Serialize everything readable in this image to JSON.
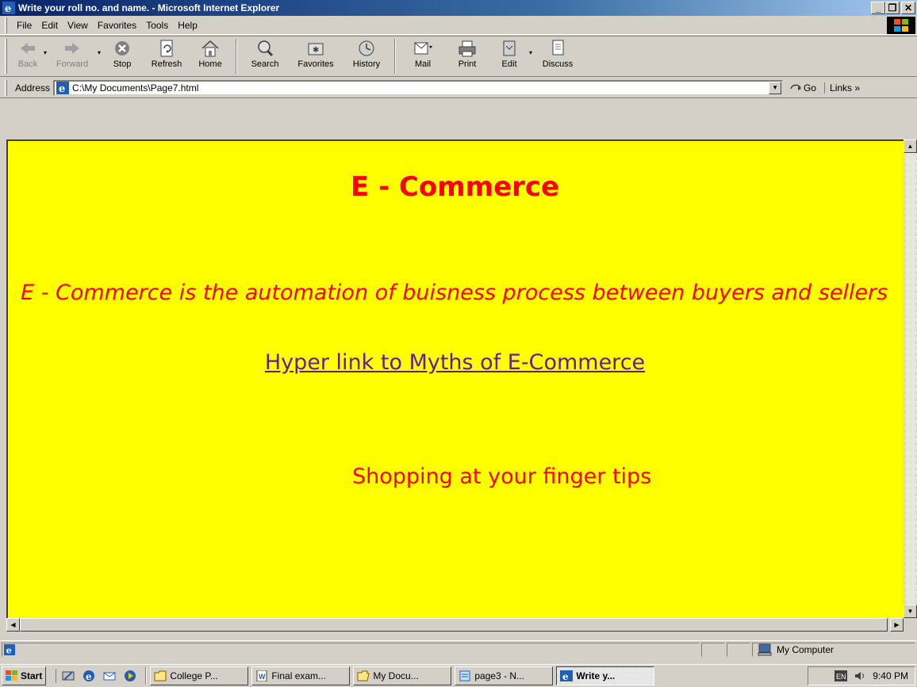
{
  "window": {
    "title": "Write your roll no. and name. - Microsoft Internet Explorer",
    "min_label": "_",
    "max_label": "❐",
    "close_label": "✕"
  },
  "menu": [
    {
      "label": "File",
      "icon": ""
    },
    {
      "label": "Edit"
    },
    {
      "label": "View"
    },
    {
      "label": "Favorites"
    },
    {
      "label": "Tools"
    },
    {
      "label": "Help"
    }
  ],
  "toolbar": {
    "back": "Back",
    "forward": "Forward",
    "stop": "Stop",
    "refresh": "Refresh",
    "home": "Home",
    "search": "Search",
    "favorites": "Favorites",
    "history": "History",
    "mail": "Mail",
    "print": "Print",
    "edit": "Edit",
    "discuss": "Discuss"
  },
  "address": {
    "label": "Address",
    "value": "C:\\My Documents\\Page7.html",
    "go": "Go",
    "links": "Links »"
  },
  "page": {
    "heading": "E - Commerce",
    "paragraph": "E - Commerce is the automation of buisness process between buyers and sellers",
    "link": "Hyper link to Myths of E-Commerce",
    "tagline": "Shopping at your finger tips",
    "background_color": "#ffff00",
    "text_color": "#ff0000",
    "link_color": "#6a1b8a"
  },
  "status": {
    "zone": "My Computer"
  },
  "taskbar": {
    "start": "Start",
    "tasks": [
      {
        "label": "College P...",
        "icon": "folder-icon"
      },
      {
        "label": "Final exam...",
        "icon": "word-document-icon"
      },
      {
        "label": "My Docu...",
        "icon": "folder-open-icon"
      },
      {
        "label": "page3 - N...",
        "icon": "notepad-icon"
      },
      {
        "label": "Write y...",
        "icon": "internet-explorer-icon"
      }
    ],
    "clock": "9:40 PM"
  }
}
